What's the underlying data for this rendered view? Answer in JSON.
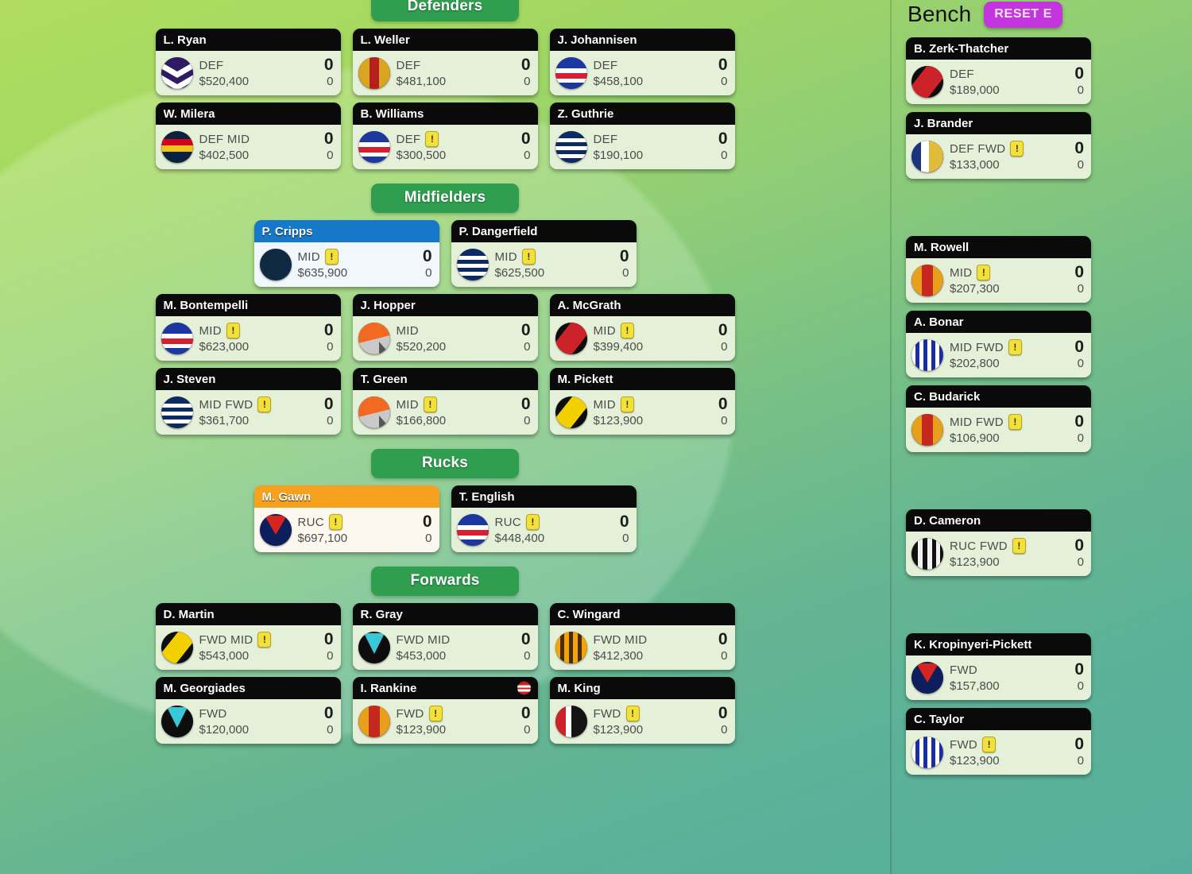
{
  "bench_panel": {
    "title": "Bench",
    "reset_label": "RESET E",
    "accent": "#c436dd"
  },
  "sections": [
    {
      "id": "defenders",
      "label": "Defenders"
    },
    {
      "id": "midfielders",
      "label": "Midfielders"
    },
    {
      "id": "rucks",
      "label": "Rucks"
    },
    {
      "id": "forwards",
      "label": "Forwards"
    }
  ],
  "field": {
    "defenders": [
      [
        {
          "name": "L. Ryan",
          "pos": "DEF",
          "price": "$520,400",
          "score": "0",
          "sub": "0",
          "warn": false,
          "status": false,
          "logo": "fremantle"
        },
        {
          "name": "L. Weller",
          "pos": "DEF",
          "price": "$481,100",
          "score": "0",
          "sub": "0",
          "warn": false,
          "status": false,
          "logo": "stkilda_red"
        },
        {
          "name": "J. Johannisen",
          "pos": "DEF",
          "price": "$458,100",
          "score": "0",
          "sub": "0",
          "warn": false,
          "status": false,
          "logo": "bulldogs"
        }
      ],
      [
        {
          "name": "W. Milera",
          "pos": "DEF MID",
          "price": "$402,500",
          "score": "0",
          "sub": "0",
          "warn": false,
          "status": false,
          "logo": "adelaide"
        },
        {
          "name": "B. Williams",
          "pos": "DEF",
          "price": "$300,500",
          "score": "0",
          "sub": "0",
          "warn": true,
          "status": false,
          "logo": "bulldogs"
        },
        {
          "name": "Z. Guthrie",
          "pos": "DEF",
          "price": "$190,100",
          "score": "0",
          "sub": "0",
          "warn": false,
          "status": false,
          "logo": "geelong"
        }
      ]
    ],
    "midfielders": [
      [
        {
          "name": "P. Cripps",
          "pos": "MID",
          "price": "$635,900",
          "score": "0",
          "sub": "0",
          "warn": true,
          "status": false,
          "logo": "carlton",
          "highlight": "captain"
        },
        {
          "name": "P. Dangerfield",
          "pos": "MID",
          "price": "$625,500",
          "score": "0",
          "sub": "0",
          "warn": true,
          "status": false,
          "logo": "geelong"
        }
      ],
      [
        {
          "name": "M. Bontempelli",
          "pos": "MID",
          "price": "$623,000",
          "score": "0",
          "sub": "0",
          "warn": true,
          "status": false,
          "logo": "bulldogs"
        },
        {
          "name": "J. Hopper",
          "pos": "MID",
          "price": "$520,200",
          "score": "0",
          "sub": "0",
          "warn": false,
          "status": false,
          "logo": "gws"
        },
        {
          "name": "A. McGrath",
          "pos": "MID",
          "price": "$399,400",
          "score": "0",
          "sub": "0",
          "warn": true,
          "status": false,
          "logo": "essendon"
        }
      ],
      [
        {
          "name": "J. Steven",
          "pos": "MID FWD",
          "price": "$361,700",
          "score": "0",
          "sub": "0",
          "warn": true,
          "status": false,
          "logo": "geelong"
        },
        {
          "name": "T. Green",
          "pos": "MID",
          "price": "$166,800",
          "score": "0",
          "sub": "0",
          "warn": true,
          "status": false,
          "logo": "gws"
        },
        {
          "name": "M. Pickett",
          "pos": "MID",
          "price": "$123,900",
          "score": "0",
          "sub": "0",
          "warn": true,
          "status": false,
          "logo": "richmond"
        }
      ]
    ],
    "rucks": [
      [
        {
          "name": "M. Gawn",
          "pos": "RUC",
          "price": "$697,100",
          "score": "0",
          "sub": "0",
          "warn": true,
          "status": false,
          "logo": "melbourne",
          "highlight": "vice"
        },
        {
          "name": "T. English",
          "pos": "RUC",
          "price": "$448,400",
          "score": "0",
          "sub": "0",
          "warn": true,
          "status": false,
          "logo": "bulldogs"
        }
      ]
    ],
    "forwards": [
      [
        {
          "name": "D. Martin",
          "pos": "FWD MID",
          "price": "$543,000",
          "score": "0",
          "sub": "0",
          "warn": true,
          "status": false,
          "logo": "richmond"
        },
        {
          "name": "R. Gray",
          "pos": "FWD MID",
          "price": "$453,000",
          "score": "0",
          "sub": "0",
          "warn": false,
          "status": false,
          "logo": "portadelaide"
        },
        {
          "name": "C. Wingard",
          "pos": "FWD MID",
          "price": "$412,300",
          "score": "0",
          "sub": "0",
          "warn": false,
          "status": false,
          "logo": "hawthorn"
        }
      ],
      [
        {
          "name": "M. Georgiades",
          "pos": "FWD",
          "price": "$120,000",
          "score": "0",
          "sub": "0",
          "warn": false,
          "status": false,
          "logo": "portadelaide"
        },
        {
          "name": "I. Rankine",
          "pos": "FWD",
          "price": "$123,900",
          "score": "0",
          "sub": "0",
          "warn": true,
          "status": true,
          "logo": "goldcoast"
        },
        {
          "name": "M. King",
          "pos": "FWD",
          "price": "$123,900",
          "score": "0",
          "sub": "0",
          "warn": true,
          "status": false,
          "logo": "stkilda"
        }
      ]
    ]
  },
  "bench": [
    {
      "name": "B. Zerk-Thatcher",
      "pos": "DEF",
      "price": "$189,000",
      "score": "0",
      "sub": "0",
      "warn": false,
      "status": false,
      "logo": "essendon",
      "gap_after": false
    },
    {
      "name": "J. Brander",
      "pos": "DEF FWD",
      "price": "$133,000",
      "score": "0",
      "sub": "0",
      "warn": true,
      "status": false,
      "logo": "westcoast",
      "gap_after": true
    },
    {
      "name": "M. Rowell",
      "pos": "MID",
      "price": "$207,300",
      "score": "0",
      "sub": "0",
      "warn": true,
      "status": false,
      "logo": "goldcoast",
      "gap_after": false
    },
    {
      "name": "A. Bonar",
      "pos": "MID FWD",
      "price": "$202,800",
      "score": "0",
      "sub": "0",
      "warn": true,
      "status": false,
      "logo": "northmelbourne",
      "gap_after": false
    },
    {
      "name": "C. Budarick",
      "pos": "MID FWD",
      "price": "$106,900",
      "score": "0",
      "sub": "0",
      "warn": true,
      "status": false,
      "logo": "goldcoast",
      "gap_after": true
    },
    {
      "name": "D. Cameron",
      "pos": "RUC FWD",
      "price": "$123,900",
      "score": "0",
      "sub": "0",
      "warn": true,
      "status": false,
      "logo": "collingwood",
      "gap_after": true
    },
    {
      "name": "K. Kropinyeri-Pickett",
      "pos": "FWD",
      "price": "$157,800",
      "score": "0",
      "sub": "0",
      "warn": false,
      "status": false,
      "logo": "melbourne",
      "gap_after": false
    },
    {
      "name": "C. Taylor",
      "pos": "FWD",
      "price": "$123,900",
      "score": "0",
      "sub": "0",
      "warn": true,
      "status": false,
      "logo": "northmelbourne",
      "gap_after": false
    }
  ],
  "icons": {
    "warning": "!",
    "status": "injury-badge"
  }
}
